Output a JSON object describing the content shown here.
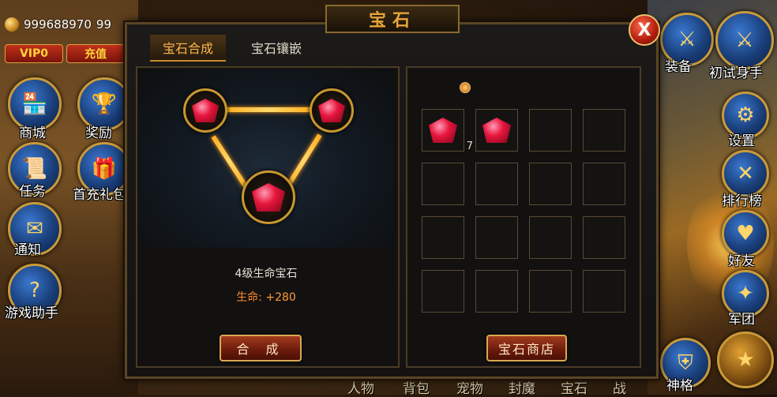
{
  "topbar": {
    "gold": "999688970",
    "gold_secondary": "99",
    "vip_label": "VIP0",
    "recharge_label": "充值"
  },
  "left_menu": [
    {
      "label": "商城",
      "icon": "shop-icon"
    },
    {
      "label": "奖励",
      "icon": "reward-icon"
    },
    {
      "label": "任务",
      "icon": "task-scroll-icon"
    },
    {
      "label": "首充礼包",
      "icon": "first-recharge-gift-icon"
    },
    {
      "label": "通知",
      "icon": "notice-icon"
    },
    {
      "label": "游戏助手",
      "icon": "question-icon"
    }
  ],
  "right_menu": [
    {
      "label": "装备",
      "icon": "equipment-icon"
    },
    {
      "label": "初试身手",
      "icon": "crossed-swords-icon"
    },
    {
      "label": "设置",
      "icon": "gear-icon"
    },
    {
      "label": "排行榜",
      "icon": "ranking-icon"
    },
    {
      "label": "好友",
      "icon": "friends-heart-icon"
    },
    {
      "label": "军团",
      "icon": "legion-icon"
    },
    {
      "label": "神格",
      "icon": "divinity-icon"
    }
  ],
  "dialog": {
    "title": "宝石",
    "tabs": [
      {
        "label": "宝石合成",
        "active": true
      },
      {
        "label": "宝石镶嵌",
        "active": false
      }
    ],
    "craft": {
      "result_name": "4级生命宝石",
      "attr_label": "生命:",
      "attr_value": "+280",
      "synth_button": "合 成"
    },
    "inventory": {
      "slots": [
        {
          "item": "red-gem",
          "count": "7"
        },
        {
          "item": "red-gem",
          "count": ""
        },
        {},
        {},
        {},
        {},
        {},
        {},
        {},
        {},
        {},
        {},
        {},
        {},
        {},
        {}
      ],
      "shop_button": "宝石商店"
    }
  },
  "bottom_bar": [
    "人物",
    "背包",
    "宠物",
    "封魔",
    "宝石",
    "战"
  ],
  "colors": {
    "title_gold": "#e6a43a",
    "tab_active": "#ffb34a",
    "attr_orange": "#ff8a2a",
    "gem_red": "#e8163e",
    "frame_gold": "#c9972e"
  }
}
